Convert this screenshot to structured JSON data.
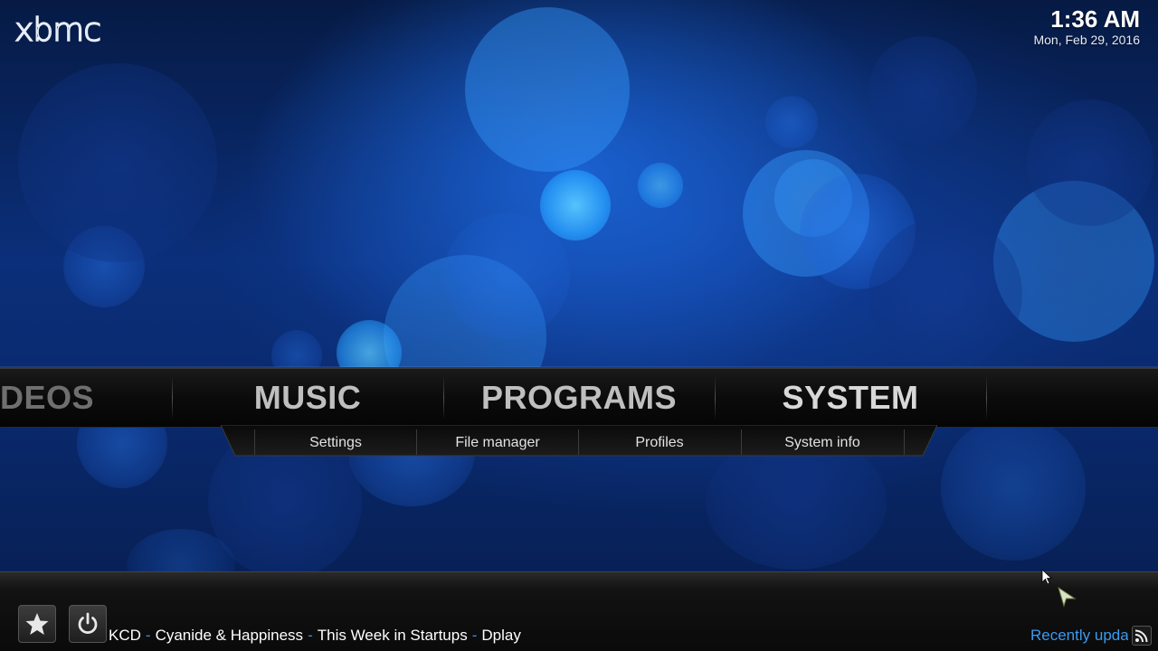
{
  "app": {
    "logo_text": "xbmc",
    "clock_time": "1:36 AM",
    "clock_date": "Mon, Feb 29, 2016"
  },
  "main_menu": {
    "items": [
      {
        "label": "DEOS",
        "state": "partial"
      },
      {
        "label": "MUSIC",
        "state": "normal"
      },
      {
        "label": "PROGRAMS",
        "state": "normal"
      },
      {
        "label": "SYSTEM",
        "state": "focused"
      }
    ]
  },
  "sub_menu": {
    "items": [
      {
        "label": "Settings"
      },
      {
        "label": "File manager"
      },
      {
        "label": "Profiles"
      },
      {
        "label": "System info"
      }
    ]
  },
  "bottom_bar": {
    "favourites_icon": "star-icon",
    "power_icon": "power-icon",
    "ticker_items": [
      "KCD",
      "Cyanide & Happiness",
      "This Week in Startups",
      "Dplay"
    ],
    "ticker_separator": "-",
    "rss_label": "Recently upda",
    "rss_icon": "rss-icon"
  },
  "colors": {
    "accent_blue": "#3a9af0",
    "background_blue": "#0b2f7a",
    "menu_text": "#bfbfbf"
  }
}
